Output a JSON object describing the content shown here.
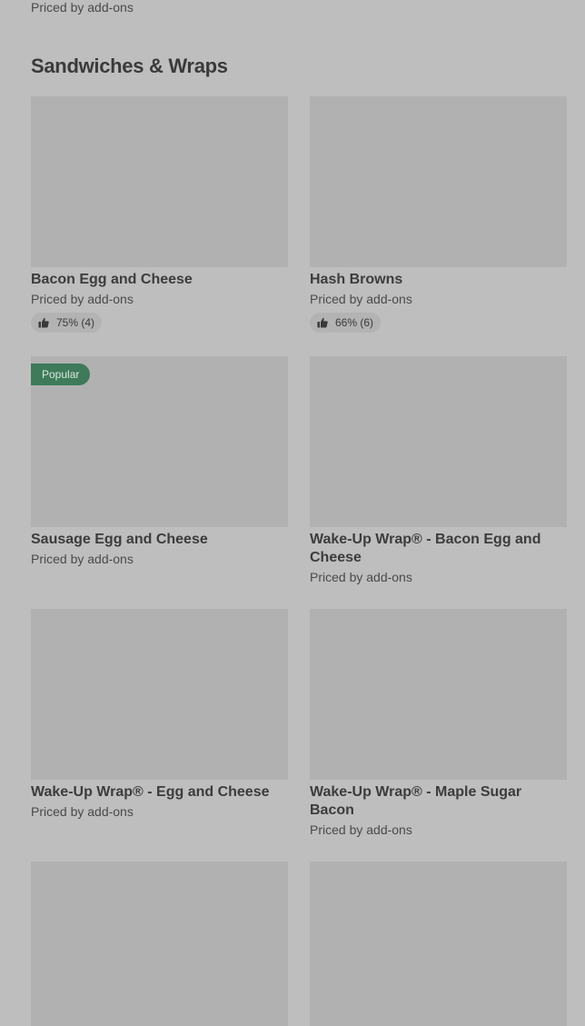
{
  "previous_item": {
    "price_label": "Priced by add-ons"
  },
  "section": {
    "title": "Sandwiches & Wraps"
  },
  "items": [
    {
      "name": "Bacon Egg and Cheese",
      "price_label": "Priced by add-ons",
      "rating": "75% (4)"
    },
    {
      "name": "Hash Browns",
      "price_label": "Priced by add-ons",
      "rating": "66% (6)"
    },
    {
      "name": "Sausage Egg and Cheese",
      "price_label": "Priced by add-ons",
      "badge": "Popular"
    },
    {
      "name": "Wake-Up Wrap® - Bacon Egg and Cheese",
      "price_label": "Priced by add-ons"
    },
    {
      "name": "Wake-Up Wrap® - Egg and Cheese",
      "price_label": "Priced by add-ons"
    },
    {
      "name": "Wake-Up Wrap® - Maple Sugar Bacon",
      "price_label": "Priced by add-ons"
    },
    {},
    {}
  ],
  "colors": {
    "background": "#bebebe",
    "image_placeholder": "#b1b1b1",
    "badge_green": "#3f7a5a"
  },
  "icons": {
    "rating": "thumbs-up-icon"
  }
}
